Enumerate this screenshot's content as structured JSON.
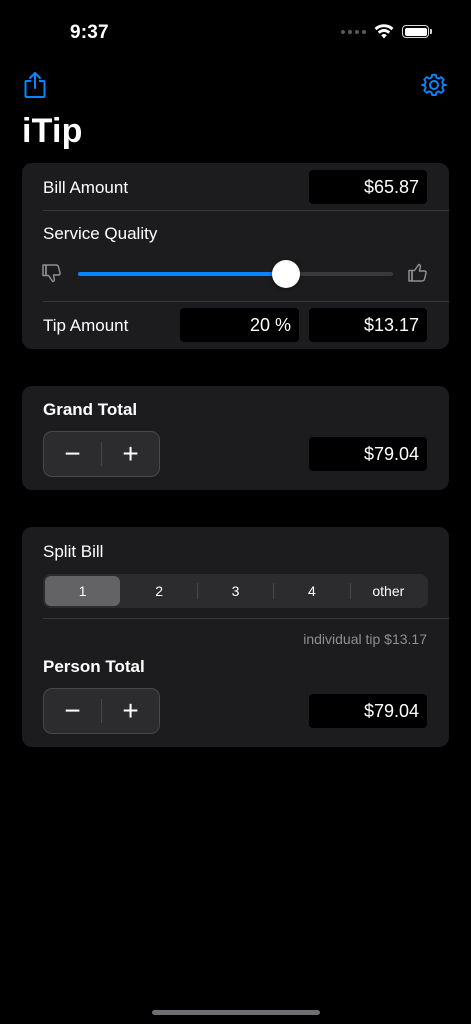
{
  "status_bar": {
    "time": "9:37"
  },
  "nav": {
    "title": "iTip",
    "share_icon": "share-icon",
    "settings_icon": "gear-icon"
  },
  "bill_section": {
    "bill_label": "Bill Amount",
    "bill_value": "$65.87",
    "service_label": "Service Quality",
    "service_level": 0.66,
    "tip_label": "Tip Amount",
    "tip_percent": "20 %",
    "tip_value": "$13.17",
    "low_icon": "thumbs-down-icon",
    "high_icon": "thumbs-up-icon"
  },
  "grand_total": {
    "label": "Grand Total",
    "value": "$79.04",
    "minus": "−",
    "plus": "+"
  },
  "split": {
    "label": "Split Bill",
    "options": [
      "1",
      "2",
      "3",
      "4",
      "other"
    ],
    "selected": "1",
    "individual_tip": "individual tip $13.17",
    "person_label": "Person Total",
    "person_value": "$79.04",
    "minus": "−",
    "plus": "+"
  },
  "colors": {
    "accent": "#0a84ff",
    "background": "#000000",
    "card": "#1c1c1e"
  }
}
